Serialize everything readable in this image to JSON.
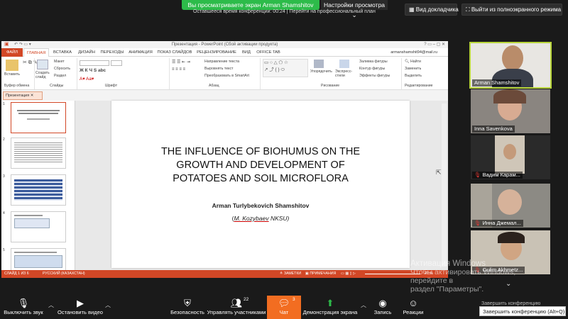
{
  "zoom": {
    "share_banner": "Вы просматриваете экран Arman Shamshitov",
    "view_options": "Настройки просмотра",
    "time_banner": "Оставшееся время конференции: 00:24 | Перейти на профессиональный план",
    "speaker_view": "Вид докладчика",
    "exit_fullscreen": "Выйти из полноэкранного режима"
  },
  "ppt": {
    "title": "Презентация - PowerPoint (Сбой активации продукта)",
    "user": "armanshamshit94@mail.ru",
    "tabs": [
      "ФАЙЛ",
      "ГЛАВНАЯ",
      "ВСТАВКА",
      "ДИЗАЙН",
      "ПЕРЕХОДЫ",
      "АНИМАЦИЯ",
      "ПОКАЗ СЛАЙДОВ",
      "РЕЦЕНЗИРОВАНИЕ",
      "ВИД",
      "OFFICE TAB"
    ],
    "ribbon": {
      "paste": "Вставить",
      "layout": "Макет",
      "reset": "Сбросить",
      "section": "Раздел",
      "new_slide": "Создать слайд",
      "text_direction": "Направление текста",
      "align_text": "Выровнять текст",
      "smartart": "Преобразовать в SmartArt",
      "arrange": "Упорядочить",
      "quick_styles": "Экспресс-стили",
      "shape_fill": "Заливка фигуры",
      "shape_outline": "Контур фигуры",
      "shape_effects": "Эффекты фигуры",
      "find": "Найти",
      "replace": "Заменить",
      "select": "Выделить",
      "g_clipboard": "Буфер обмена",
      "g_slides": "Слайды",
      "g_font": "Шрифт",
      "g_paragraph": "Абзац",
      "g_drawing": "Рисование",
      "g_editing": "Редактирование"
    },
    "pane_tab": "Презентация",
    "slide": {
      "title": "THE INFLUENCE OF BIOHUMUS ON THE GROWTH AND DEVELOPMENT OF POTATOES AND SOIL MICROFLORA",
      "author": "Arman Turlybekovich Shamshitov",
      "aff_open": "(",
      "aff_name": "M. Kozybaev",
      "aff_rest": " NKSU)"
    },
    "thumbs": [
      "1",
      "2",
      "3",
      "4",
      "5"
    ],
    "status": {
      "slide": "СЛАЙД 1 ИЗ 6",
      "lang": "РУССКИЙ (КАЗАХСТАН)",
      "notes": "ЗАМЕТКИ",
      "comments": "ПРИМЕЧАНИЯ",
      "zoom": "47 %"
    }
  },
  "participants": [
    {
      "name": "Arman Shamshitov"
    },
    {
      "name": "Inna Savenkova"
    },
    {
      "name": "Вадим Карам..."
    },
    {
      "name": "Инна Джемал..."
    },
    {
      "name": "Gulim Akhmetz..."
    }
  ],
  "watermark": {
    "line1": "Активация Windows",
    "line2": "Чтобы активировать Windows, перейдите в",
    "line3": "раздел \"Параметры\"."
  },
  "toolbar": {
    "mute": "Выключить звук",
    "video": "Остановить видео",
    "security": "Безопасность",
    "participants": "Управлять участниками",
    "participants_count": "22",
    "chat": "Чат",
    "chat_count": "3",
    "share": "Демонстрация экрана",
    "record": "Запись",
    "reactions": "Реакции",
    "tooltip": "Завершить конференцию (Alt+Q)",
    "end_hint": "Завершить конференцию"
  }
}
